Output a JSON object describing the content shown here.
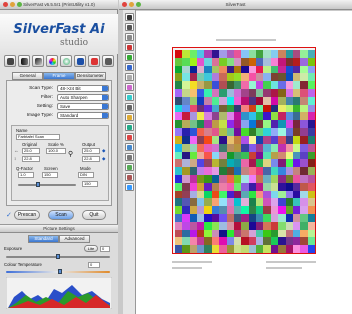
{
  "left_window": {
    "title": "SilverFast v6.5.5r1 (PrintUtility v1.0)",
    "logo": {
      "brand": "SilverFast Ai",
      "edition": "studio"
    },
    "toolbar_icons": [
      "scan-icon",
      "histogram-icon",
      "gradation-icon",
      "selective-color-icon",
      "global-color-icon",
      "unsharp-mask-icon",
      "descreen-icon",
      "dust-icon"
    ],
    "tabs": [
      "General",
      "Frame",
      "Densitometer"
    ],
    "active_tab": "Frame",
    "settings": {
      "scan_type": {
        "label": "Scan Type:",
        "value": "48->24 Bit"
      },
      "filter": {
        "label": "Filter:",
        "value": "Auto Sharpen"
      },
      "setting": {
        "label": "Setting:",
        "value": "Save"
      },
      "image_type": {
        "label": "Image Type:",
        "value": "Standard"
      }
    },
    "frame": {
      "name_label": "Name",
      "name_value": "Farbtafel Scan",
      "original_label": "Original",
      "scale_label": "Scale %",
      "output_label": "Output",
      "w_orig": "25.0",
      "h_orig": "22.8",
      "scale": "100.0",
      "w_out": "25.0",
      "h_out": "22.8",
      "qfactor_label": "Q-Factor",
      "screen_label": "Screen",
      "mode_label": "Mode",
      "qfactor_value": "1.0",
      "screen_value": "150",
      "mode_value": "DIN",
      "res_value": "150"
    },
    "buttons": {
      "prescan": "Prescan",
      "scan": "Scan",
      "quit": "Quit"
    },
    "picture_settings": {
      "title": "Picture Settings",
      "tabs": [
        "Standard",
        "Advanced"
      ],
      "active_tab": "Standard",
      "exposure_label": "Exposure",
      "exposure_button": "Lite",
      "exposure_value": "0",
      "colour_temp_label": "Colour Temperature",
      "colour_temp_value": "0",
      "exposure_level": 0.5,
      "colour_temp_level": 0.52
    }
  },
  "right_window": {
    "title": "SilverFast",
    "side_tools": [
      "frame-icon",
      "undo-icon",
      "clipboard-icon",
      "gray-balance-icon",
      "eyedropper-icon",
      "move-icon",
      "zoom-icon",
      "rotate-icon",
      "magnify-icon",
      "info-icon",
      "curve-icon",
      "color-icon",
      "expert-icon",
      "target-icon",
      "mono-icon",
      "density-icon",
      "overlay-icon",
      "help-icon"
    ]
  }
}
